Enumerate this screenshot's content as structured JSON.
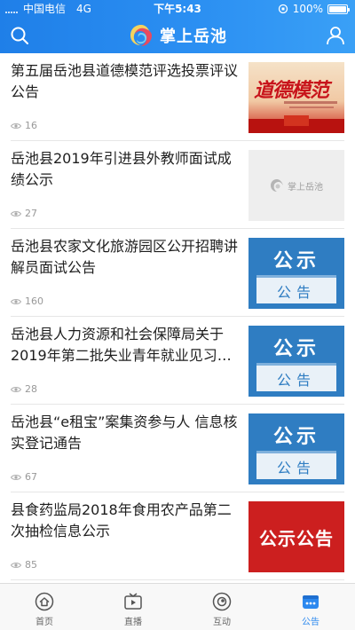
{
  "status_bar": {
    "carrier": "中国电信",
    "network": "4G",
    "time": "下午5:43",
    "battery_text": "100%",
    "battery_level": 1.0
  },
  "header": {
    "title": "掌上岳池",
    "search_icon": "search-icon",
    "user_icon": "user-icon",
    "logo_icon": "swirl-logo-icon"
  },
  "colors": {
    "header_gradient_start": "#1f7fe8",
    "header_gradient_end": "#3aa0f6",
    "tab_active": "#2c89ef",
    "notice_blue": "#2f7dc2",
    "notice_red": "#cc1f1f"
  },
  "news": [
    {
      "headline": "第五届岳池县道德模范评选投票评议公告",
      "views": "16",
      "thumb_type": "red-banner",
      "thumb_text": "道德模范"
    },
    {
      "headline": "岳池县2019年引进县外教师面试成绩公示",
      "views": "27",
      "thumb_type": "placeholder",
      "thumb_text": "掌上岳池"
    },
    {
      "headline": "岳池县农家文化旅游园区公开招聘讲解员面试公告",
      "views": "160",
      "thumb_type": "blue-notice",
      "thumb_top": "公示",
      "thumb_bottom": "公告"
    },
    {
      "headline": "岳池县人力资源和社会保障局关于2019年第二批失业青年就业见习…",
      "views": "28",
      "thumb_type": "blue-notice",
      "thumb_top": "公示",
      "thumb_bottom": "公告"
    },
    {
      "headline": "岳池县“e租宝”案集资参与人 信息核实登记通告",
      "views": "67",
      "thumb_type": "blue-notice",
      "thumb_top": "公示",
      "thumb_bottom": "公告"
    },
    {
      "headline": "县食药监局2018年食用农产品第二次抽检信息公示",
      "views": "85",
      "thumb_type": "red-notice",
      "thumb_text": "公示公告"
    }
  ],
  "tabs": [
    {
      "label": "首页",
      "icon": "home-icon",
      "active": false
    },
    {
      "label": "直播",
      "icon": "tv-play-icon",
      "active": false
    },
    {
      "label": "互动",
      "icon": "interact-icon",
      "active": false
    },
    {
      "label": "公告",
      "icon": "announcement-icon",
      "active": true
    }
  ]
}
